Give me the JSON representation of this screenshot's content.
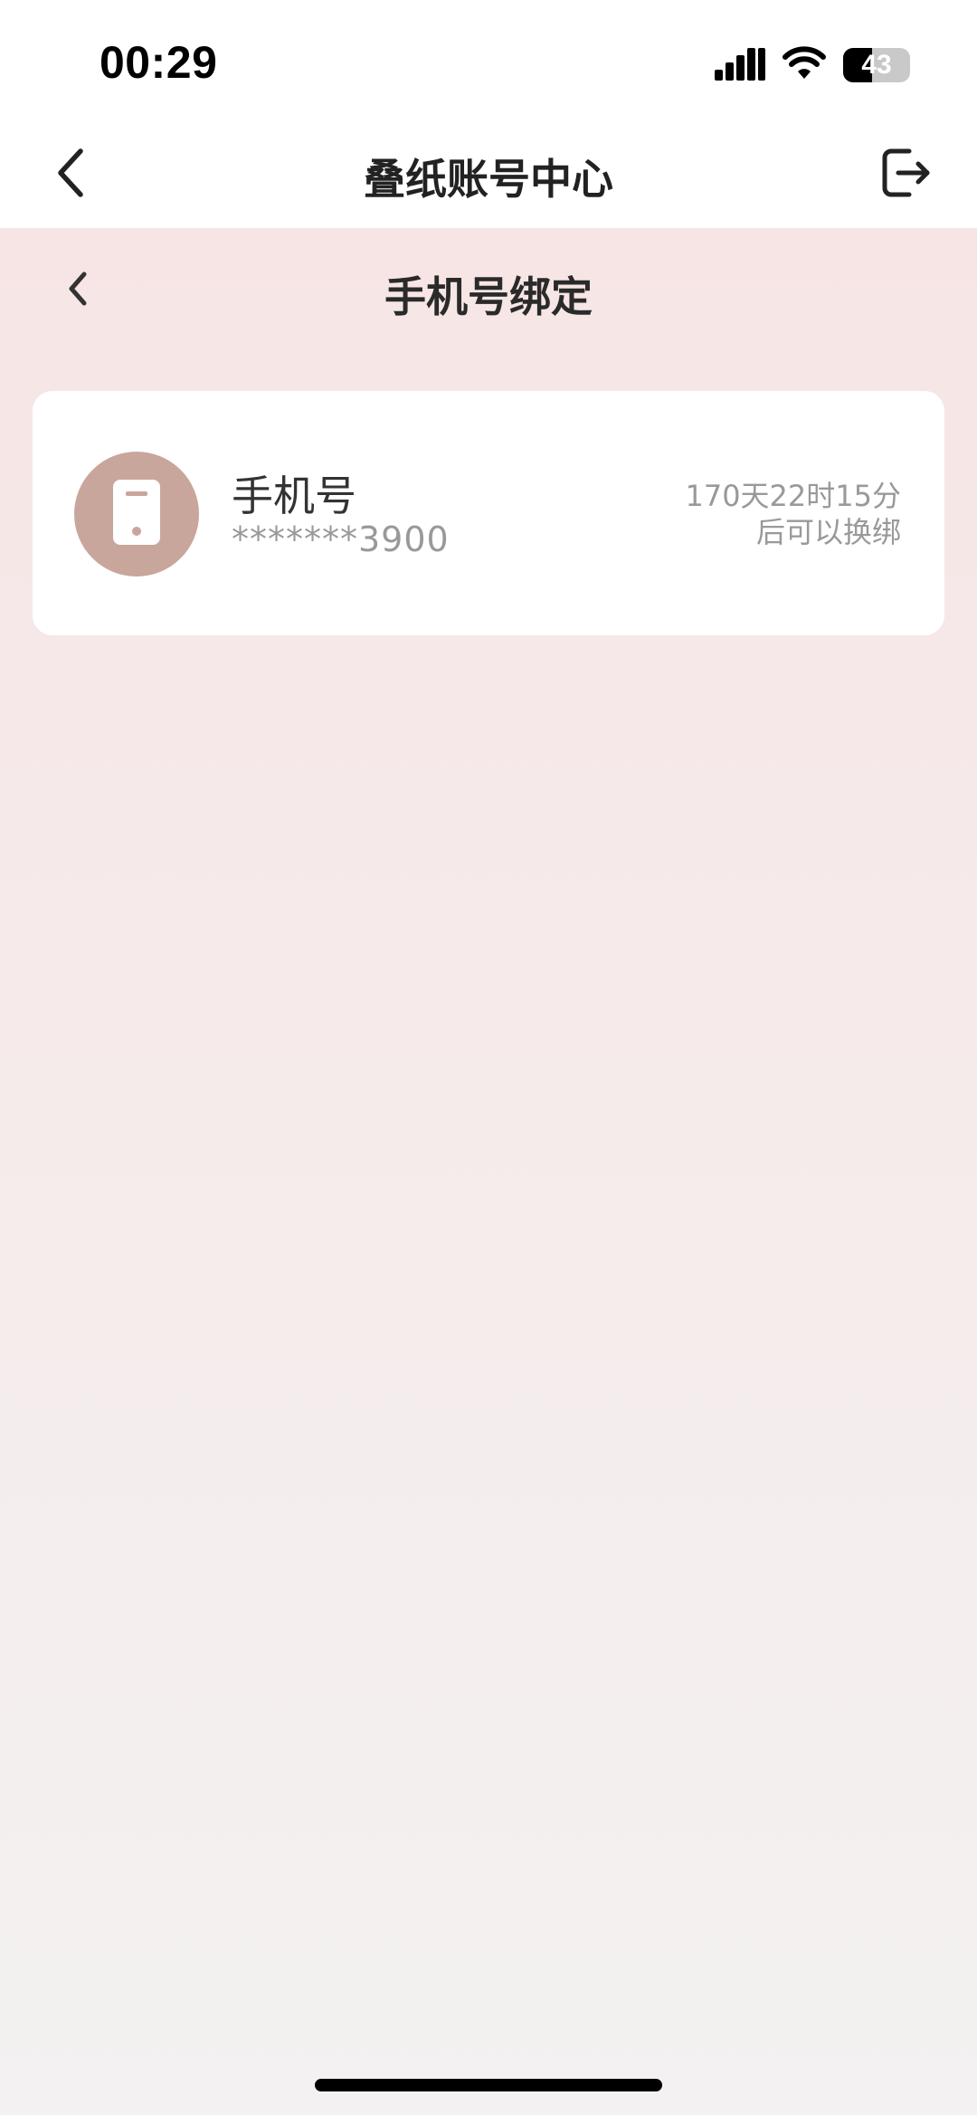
{
  "status_bar": {
    "time": "00:29",
    "battery_level": "43",
    "battery_fraction": 0.43,
    "icons": [
      "cellular-signal-icon",
      "wifi-icon",
      "battery-icon"
    ]
  },
  "nav": {
    "title": "叠纸账号中心",
    "back_icon": "chevron-left-icon",
    "logout_icon": "logout-icon"
  },
  "sub_header": {
    "title": "手机号绑定",
    "back_icon": "chevron-left-icon"
  },
  "phone_card": {
    "icon": "phone-icon",
    "label": "手机号",
    "value": "*******3900",
    "note_line1": "170天22时15分",
    "note_line2": "后可以换绑"
  },
  "colors": {
    "accent": "#c8a69c",
    "background_top": "#f7e5e5",
    "background_bottom": "#f3f1f1",
    "muted_text": "#999999"
  }
}
